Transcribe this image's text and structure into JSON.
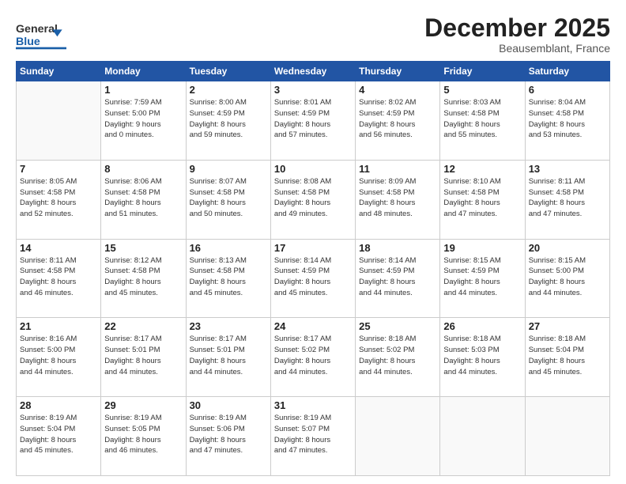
{
  "header": {
    "logo_general": "General",
    "logo_blue": "Blue",
    "month": "December 2025",
    "location": "Beausemblant, France"
  },
  "weekdays": [
    "Sunday",
    "Monday",
    "Tuesday",
    "Wednesday",
    "Thursday",
    "Friday",
    "Saturday"
  ],
  "weeks": [
    [
      {
        "day": "",
        "info": ""
      },
      {
        "day": "1",
        "info": "Sunrise: 7:59 AM\nSunset: 5:00 PM\nDaylight: 9 hours\nand 0 minutes."
      },
      {
        "day": "2",
        "info": "Sunrise: 8:00 AM\nSunset: 4:59 PM\nDaylight: 8 hours\nand 59 minutes."
      },
      {
        "day": "3",
        "info": "Sunrise: 8:01 AM\nSunset: 4:59 PM\nDaylight: 8 hours\nand 57 minutes."
      },
      {
        "day": "4",
        "info": "Sunrise: 8:02 AM\nSunset: 4:59 PM\nDaylight: 8 hours\nand 56 minutes."
      },
      {
        "day": "5",
        "info": "Sunrise: 8:03 AM\nSunset: 4:58 PM\nDaylight: 8 hours\nand 55 minutes."
      },
      {
        "day": "6",
        "info": "Sunrise: 8:04 AM\nSunset: 4:58 PM\nDaylight: 8 hours\nand 53 minutes."
      }
    ],
    [
      {
        "day": "7",
        "info": "Sunrise: 8:05 AM\nSunset: 4:58 PM\nDaylight: 8 hours\nand 52 minutes."
      },
      {
        "day": "8",
        "info": "Sunrise: 8:06 AM\nSunset: 4:58 PM\nDaylight: 8 hours\nand 51 minutes."
      },
      {
        "day": "9",
        "info": "Sunrise: 8:07 AM\nSunset: 4:58 PM\nDaylight: 8 hours\nand 50 minutes."
      },
      {
        "day": "10",
        "info": "Sunrise: 8:08 AM\nSunset: 4:58 PM\nDaylight: 8 hours\nand 49 minutes."
      },
      {
        "day": "11",
        "info": "Sunrise: 8:09 AM\nSunset: 4:58 PM\nDaylight: 8 hours\nand 48 minutes."
      },
      {
        "day": "12",
        "info": "Sunrise: 8:10 AM\nSunset: 4:58 PM\nDaylight: 8 hours\nand 47 minutes."
      },
      {
        "day": "13",
        "info": "Sunrise: 8:11 AM\nSunset: 4:58 PM\nDaylight: 8 hours\nand 47 minutes."
      }
    ],
    [
      {
        "day": "14",
        "info": "Sunrise: 8:11 AM\nSunset: 4:58 PM\nDaylight: 8 hours\nand 46 minutes."
      },
      {
        "day": "15",
        "info": "Sunrise: 8:12 AM\nSunset: 4:58 PM\nDaylight: 8 hours\nand 45 minutes."
      },
      {
        "day": "16",
        "info": "Sunrise: 8:13 AM\nSunset: 4:58 PM\nDaylight: 8 hours\nand 45 minutes."
      },
      {
        "day": "17",
        "info": "Sunrise: 8:14 AM\nSunset: 4:59 PM\nDaylight: 8 hours\nand 45 minutes."
      },
      {
        "day": "18",
        "info": "Sunrise: 8:14 AM\nSunset: 4:59 PM\nDaylight: 8 hours\nand 44 minutes."
      },
      {
        "day": "19",
        "info": "Sunrise: 8:15 AM\nSunset: 4:59 PM\nDaylight: 8 hours\nand 44 minutes."
      },
      {
        "day": "20",
        "info": "Sunrise: 8:15 AM\nSunset: 5:00 PM\nDaylight: 8 hours\nand 44 minutes."
      }
    ],
    [
      {
        "day": "21",
        "info": "Sunrise: 8:16 AM\nSunset: 5:00 PM\nDaylight: 8 hours\nand 44 minutes."
      },
      {
        "day": "22",
        "info": "Sunrise: 8:17 AM\nSunset: 5:01 PM\nDaylight: 8 hours\nand 44 minutes."
      },
      {
        "day": "23",
        "info": "Sunrise: 8:17 AM\nSunset: 5:01 PM\nDaylight: 8 hours\nand 44 minutes."
      },
      {
        "day": "24",
        "info": "Sunrise: 8:17 AM\nSunset: 5:02 PM\nDaylight: 8 hours\nand 44 minutes."
      },
      {
        "day": "25",
        "info": "Sunrise: 8:18 AM\nSunset: 5:02 PM\nDaylight: 8 hours\nand 44 minutes."
      },
      {
        "day": "26",
        "info": "Sunrise: 8:18 AM\nSunset: 5:03 PM\nDaylight: 8 hours\nand 44 minutes."
      },
      {
        "day": "27",
        "info": "Sunrise: 8:18 AM\nSunset: 5:04 PM\nDaylight: 8 hours\nand 45 minutes."
      }
    ],
    [
      {
        "day": "28",
        "info": "Sunrise: 8:19 AM\nSunset: 5:04 PM\nDaylight: 8 hours\nand 45 minutes."
      },
      {
        "day": "29",
        "info": "Sunrise: 8:19 AM\nSunset: 5:05 PM\nDaylight: 8 hours\nand 46 minutes."
      },
      {
        "day": "30",
        "info": "Sunrise: 8:19 AM\nSunset: 5:06 PM\nDaylight: 8 hours\nand 47 minutes."
      },
      {
        "day": "31",
        "info": "Sunrise: 8:19 AM\nSunset: 5:07 PM\nDaylight: 8 hours\nand 47 minutes."
      },
      {
        "day": "",
        "info": ""
      },
      {
        "day": "",
        "info": ""
      },
      {
        "day": "",
        "info": ""
      }
    ]
  ]
}
